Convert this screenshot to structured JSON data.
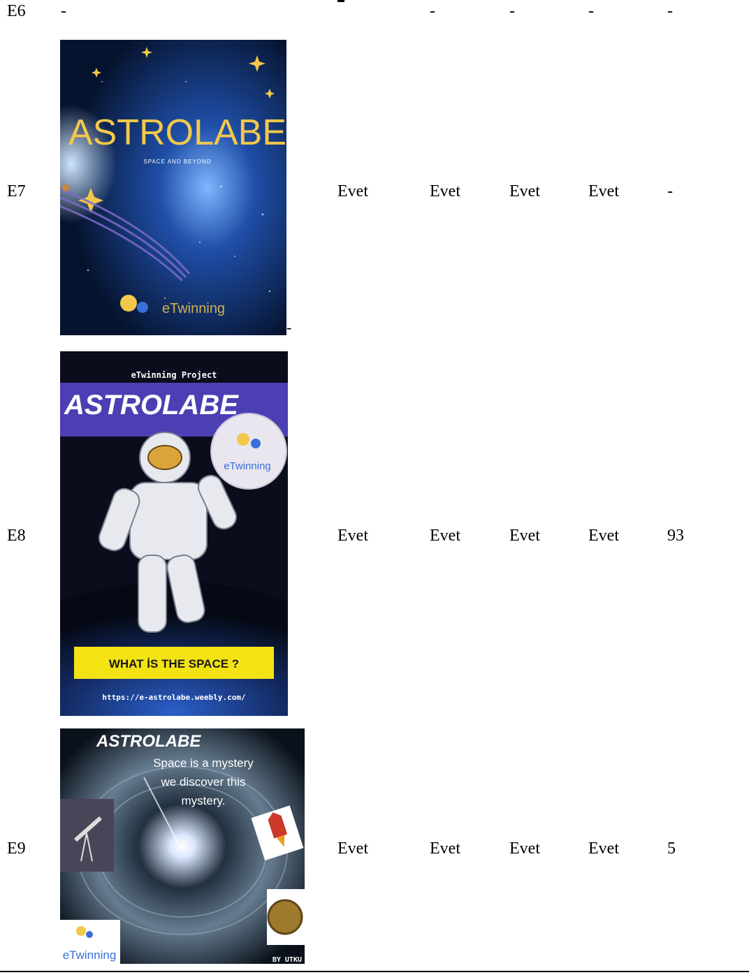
{
  "rows": [
    {
      "id": "E6",
      "cover": null,
      "cols": [
        "-",
        "-",
        "-",
        "-",
        "-"
      ],
      "first_dash": "-"
    },
    {
      "id": "E7",
      "cols": [
        "Evet",
        "Evet",
        "Evet",
        "Evet",
        "-"
      ],
      "cover": {
        "title": "ASTROLABE",
        "subtitle": "SPACE AND BEYOND",
        "logo_text": "eTwinning"
      },
      "trailing_dash": "-"
    },
    {
      "id": "E8",
      "cols": [
        "Evet",
        "Evet",
        "Evet",
        "Evet",
        "93"
      ],
      "cover": {
        "top_text": "eTwinning Project",
        "title": "ASTROLABE",
        "logo_text": "eTwinning",
        "banner": "WHAT İS THE SPACE ?",
        "url": "https://e-astrolabe.weebly.com/"
      }
    },
    {
      "id": "E9",
      "cols": [
        "Evet",
        "Evet",
        "Evet",
        "Evet",
        "5"
      ],
      "cover": {
        "title": "ASTROLABE",
        "line1": "Space is a mystery",
        "line2": "we discover this",
        "line3": "mystery.",
        "logo_text": "eTwinning",
        "byline": "BY UTKU"
      }
    }
  ],
  "colors": {
    "text": "#000000",
    "cover_gold": "#f2c84b",
    "banner_yellow": "#f3e315",
    "purple_band": "#4b3fb3"
  }
}
